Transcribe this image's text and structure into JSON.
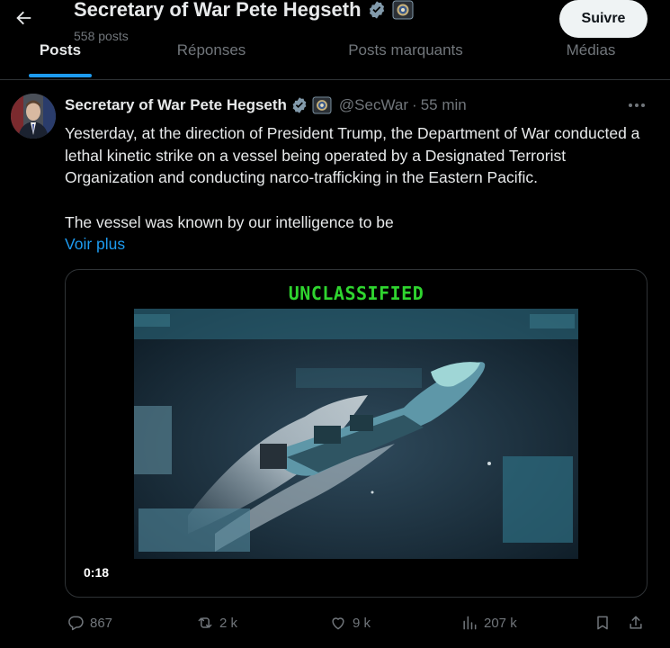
{
  "header": {
    "title": "Secretary of War Pete Hegseth",
    "post_count": "558 posts",
    "follow_label": "Suivre"
  },
  "tabs": [
    {
      "label": "Posts",
      "active": true
    },
    {
      "label": "Réponses",
      "active": false
    },
    {
      "label": "Posts marquants",
      "active": false
    },
    {
      "label": "Médias",
      "active": false
    }
  ],
  "tweet": {
    "author_name": "Secretary of War Pete Hegseth",
    "handle": "@SecWar",
    "time": "55 min",
    "paragraphs": [
      "Yesterday, at the direction of President Trump, the Department of War conducted a lethal kinetic strike on a vessel being operated by a Designated Terrorist Organization and conducting narco-trafficking in the Eastern Pacific.",
      "The vessel was known by our intelligence to be"
    ],
    "show_more": "Voir plus",
    "media": {
      "overlay_label": "UNCLASSIFIED",
      "duration": "0:18"
    },
    "actions": {
      "replies": "867",
      "reposts": "2 k",
      "likes": "9 k",
      "views": "207 k"
    }
  },
  "colors": {
    "accent": "#1d9bf0",
    "verified": "#829aab",
    "text": "#e7e9ea",
    "muted": "#71767b",
    "label_green": "#2fd52f"
  }
}
